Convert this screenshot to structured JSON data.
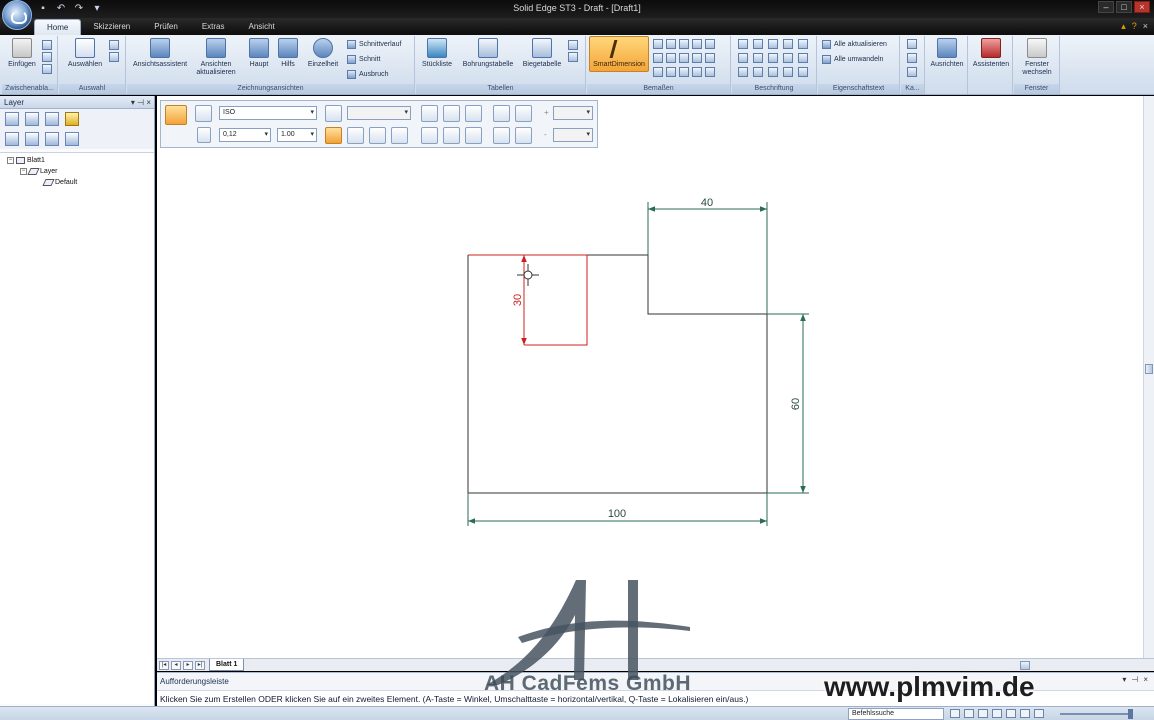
{
  "window": {
    "title": "Solid Edge ST3 - Draft - [Draft1]"
  },
  "tabs": [
    "Home",
    "Skizzieren",
    "Prüfen",
    "Extras",
    "Ansicht"
  ],
  "ribbon": {
    "groups": {
      "clipboard": "Zwischenabla...",
      "select": "Auswahl",
      "drawing_views": "Zeichnungsansichten",
      "tables": "Tabellen",
      "dimension": "Bemaßen",
      "annotation": "Beschriftung",
      "property_text": "Eigenschaftstext",
      "ka": "Ka...",
      "window": "Fenster"
    },
    "buttons": {
      "paste": "Einfügen",
      "select": "Auswählen",
      "view_wizard": "Ansichtsassistent",
      "update_views_1": "Ansichten",
      "update_views_2": "aktualisieren",
      "main": "Haupt",
      "aux": "Hilfs",
      "detail": "Einzelheit",
      "section_path": "Schnittverlauf",
      "section": "Schnitt",
      "breakout": "Ausbruch",
      "parts_list": "Stückliste",
      "hole_table": "Bohrungstabelle",
      "bend_table": "Biegetabelle",
      "smart_dimension": "SmartDimension",
      "update_all": "Alle aktualisieren",
      "convert_all": "Alle umwandeln",
      "align": "Ausrichten",
      "assistants": "Assistenten",
      "switch_window_1": "Fenster",
      "switch_window_2": "wechseln"
    }
  },
  "layer_panel": {
    "title": "Layer",
    "tree": {
      "sheet": "Blatt1",
      "layer": "Layer",
      "default": "Default"
    }
  },
  "command_bar": {
    "style": "ISO",
    "line_width": "0,12",
    "scale": "1.00",
    "plus_label": "+",
    "minus_label": "-"
  },
  "drawing": {
    "dim_top": "40",
    "dim_right": "60",
    "dim_bottom": "100",
    "dim_active": "30"
  },
  "sheet_tab": "Blatt 1",
  "prompt": {
    "title": "Aufforderungsleiste",
    "text": "Klicken Sie zum Erstellen ODER klicken Sie auf ein zweites Element. (A-Taste = Winkel, Umschalttaste = horizontal/vertikal, Q-Taste = Lokalisieren ein/aus.)"
  },
  "status": {
    "command_search": "Befehlssuche"
  },
  "watermark": {
    "company": "AH CadFems GmbH",
    "url": "www.plmvim.de"
  },
  "colors": {
    "active_edge": "#cc2020",
    "dimension": "#2d6b55",
    "geometry": "#333333"
  }
}
